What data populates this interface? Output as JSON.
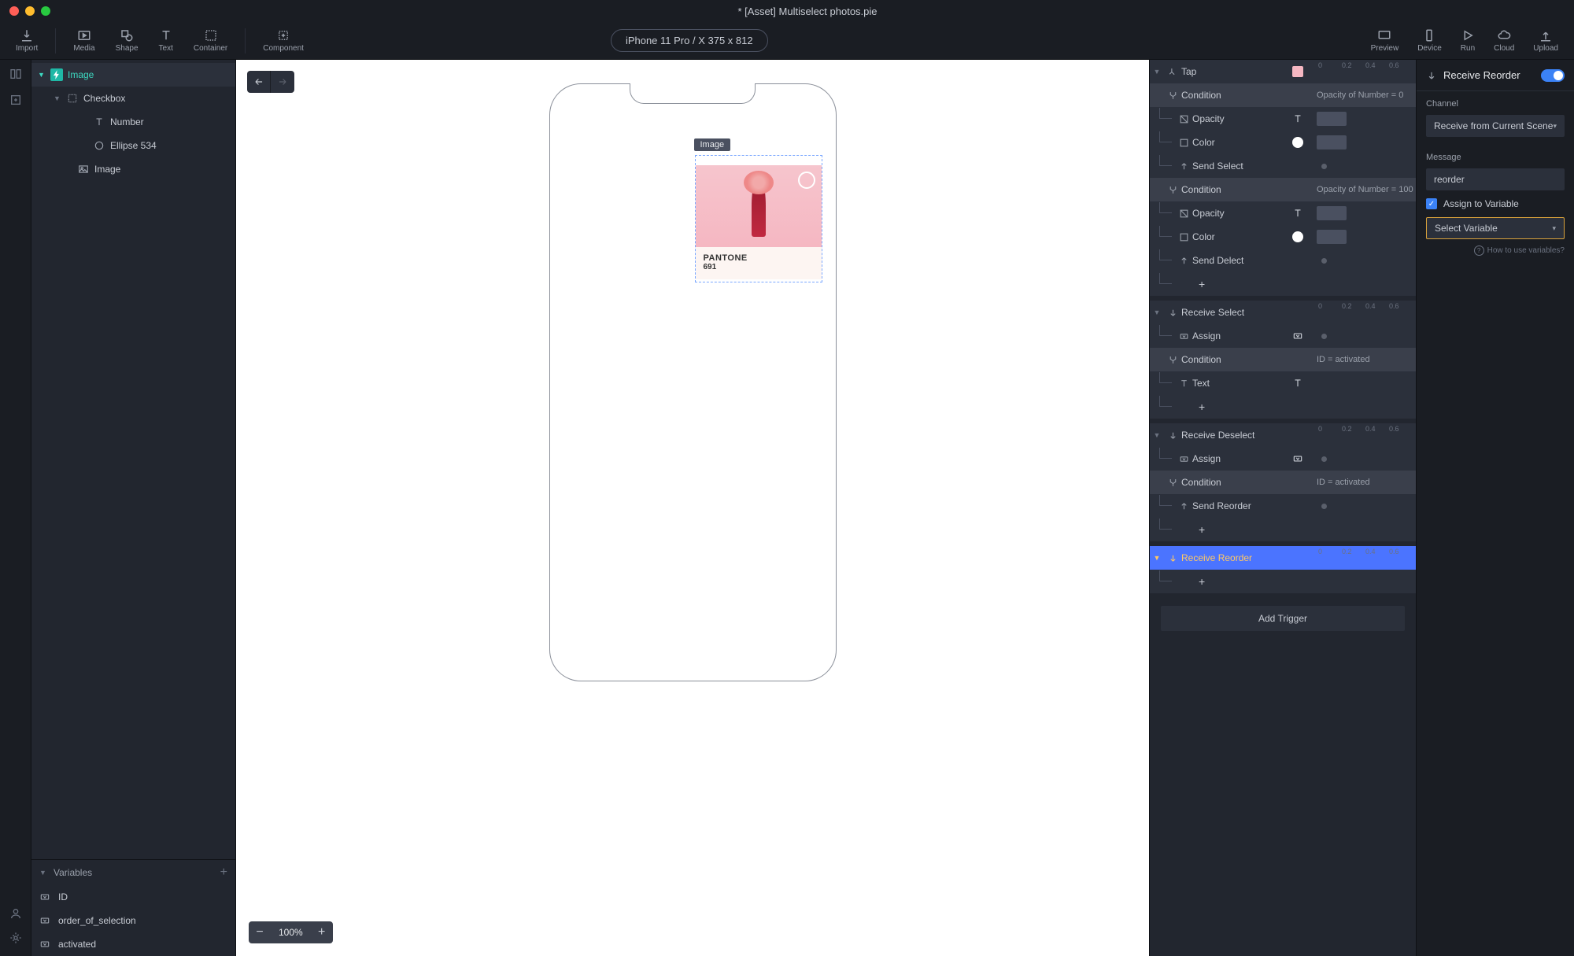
{
  "title": "* [Asset] Multiselect photos.pie",
  "device_pill": "iPhone 11 Pro / X  375 x 812",
  "toolbar": {
    "import": "Import",
    "media": "Media",
    "shape": "Shape",
    "text": "Text",
    "container": "Container",
    "component": "Component",
    "preview": "Preview",
    "device": "Device",
    "run": "Run",
    "cloud": "Cloud",
    "upload": "Upload"
  },
  "layers": {
    "image": "Image",
    "checkbox": "Checkbox",
    "number": "Number",
    "ellipse": "Ellipse 534",
    "image2": "Image"
  },
  "variables": {
    "header": "Variables",
    "id": "ID",
    "order": "order_of_selection",
    "activated": "activated"
  },
  "canvas": {
    "sel_label": "Image",
    "pantone_name": "PANTONE",
    "pantone_code": "691",
    "zoom": "100%"
  },
  "triggers": {
    "tap": "Tap",
    "condition": "Condition",
    "opacity": "Opacity",
    "color": "Color",
    "send_select": "Send Select",
    "send_delect": "Send Delect",
    "receive_select": "Receive Select",
    "assign": "Assign",
    "text": "Text",
    "receive_deselect": "Receive Deselect",
    "send_reorder": "Send Reorder",
    "receive_reorder": "Receive Reorder",
    "add_trigger": "Add Trigger",
    "cond1": "Opacity of Number = 0",
    "cond2": "Opacity of Number = 100",
    "cond3": "ID = activated",
    "cond4": "ID = activated",
    "ruler": {
      "t0": "0",
      "t2": "0.2",
      "t4": "0.4",
      "t6": "0.6"
    }
  },
  "props": {
    "title": "Receive Reorder",
    "channel_label": "Channel",
    "channel_value": "Receive from Current Scene",
    "message_label": "Message",
    "message_value": "reorder",
    "assign_label": "Assign to Variable",
    "select_var": "Select Variable",
    "help": "How to use variables?"
  }
}
